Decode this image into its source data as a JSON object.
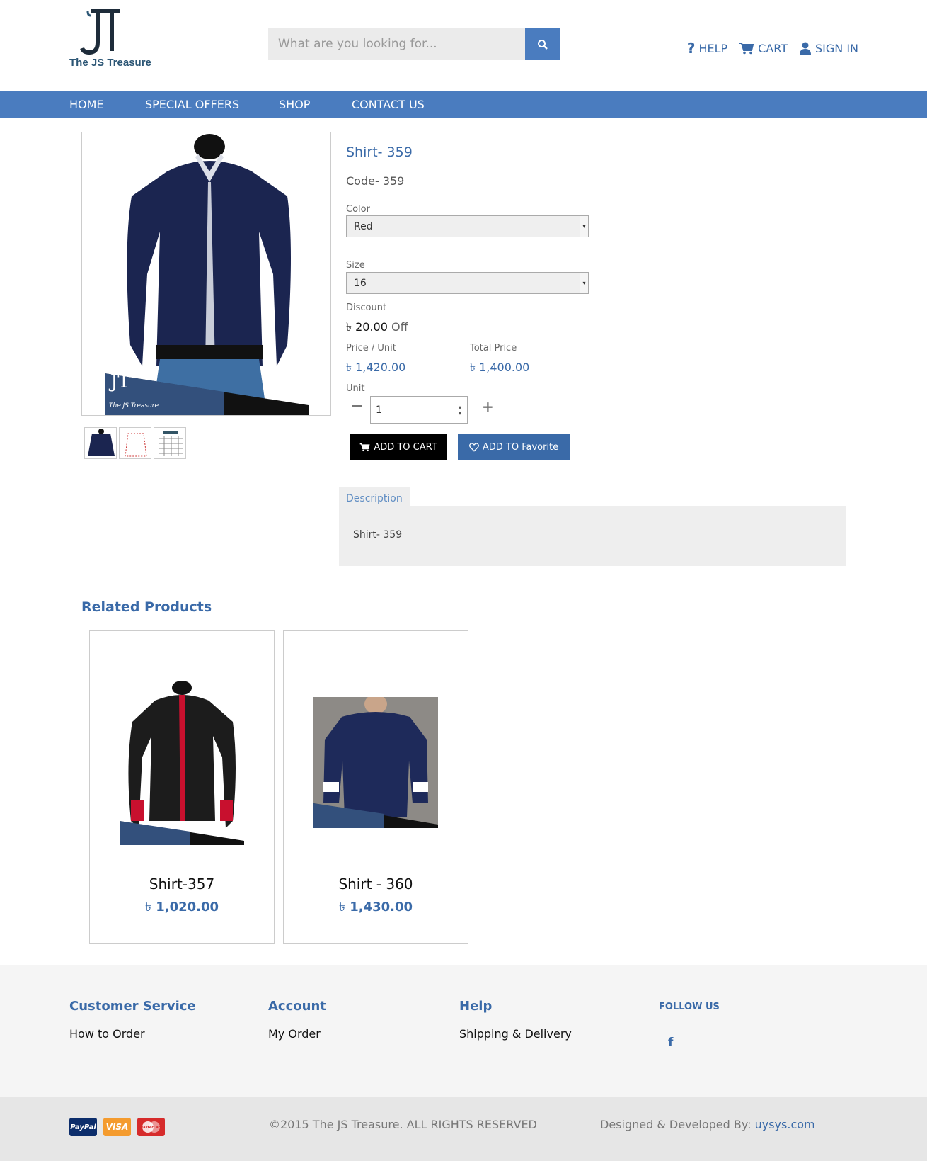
{
  "header": {
    "brand": "The JS Treasure",
    "search_placeholder": "What are you looking for...",
    "links": {
      "help": "HELP",
      "cart": "CART",
      "signin": "SIGN IN"
    }
  },
  "nav": {
    "home": "HOME",
    "special": "SPECIAL OFFERS",
    "shop": "SHOP",
    "contact": "CONTACT US"
  },
  "product": {
    "title": "Shirt- 359",
    "code": "Code- 359",
    "color_label": "Color",
    "color_value": "Red",
    "size_label": "Size",
    "size_value": "16",
    "discount_label": "Discount",
    "currency": "৳",
    "discount_value": "20.00",
    "discount_suffix": "Off",
    "price_unit_label": "Price / Unit",
    "price_unit": "1,420.00",
    "total_label": "Total Price",
    "total": "1,400.00",
    "unit_label": "Unit",
    "unit_value": "1",
    "add_cart": "ADD TO CART",
    "add_fav": "ADD TO Favorite",
    "desc_tab": "Description",
    "desc_text": "Shirt- 359",
    "image_watermark": "The JS Treasure"
  },
  "related": {
    "title": "Related Products",
    "items": [
      {
        "name": "Shirt-357",
        "price": "1,020.00"
      },
      {
        "name": "Shirt - 360",
        "price": "1,430.00"
      }
    ]
  },
  "footer": {
    "customer_service": "Customer Service",
    "how_to_order": "How to Order",
    "account": "Account",
    "my_order": "My Order",
    "help": "Help",
    "shipping": "Shipping & Delivery",
    "follow": "FOLLOW US",
    "copyright": "©2015 The JS Treasure. ALL RIGHTS RESERVED",
    "designed_by": "Designed & Developed By:",
    "designer": "uysys.com",
    "pay": {
      "paypal": "PayPal",
      "visa": "VISA",
      "mastercard": "MasterCard"
    }
  },
  "colors": {
    "accent": "#4a7cbf",
    "link": "#3a6aa8",
    "footer_bg": "#f5f5f5"
  }
}
